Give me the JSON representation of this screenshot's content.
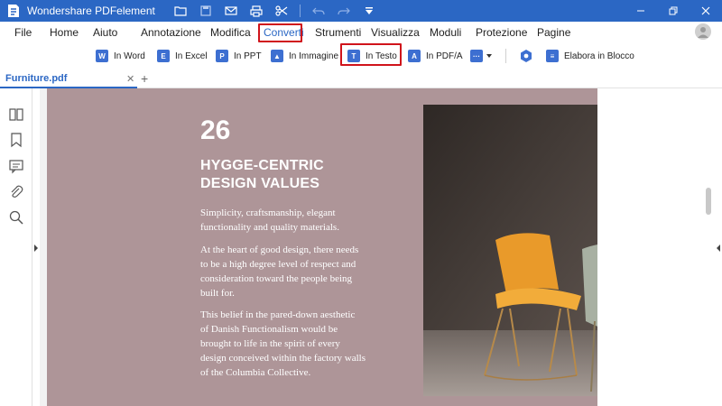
{
  "app": {
    "title": "Wondershare PDFelement"
  },
  "colors": {
    "accent": "#2b67c4",
    "highlight": "#d0141b",
    "page_bg": "#ae9598",
    "chair_yellow": "#e99a2a"
  },
  "menu": {
    "items": [
      "File",
      "Home",
      "Aiuto",
      "Annotazione",
      "Modifica",
      "Converti",
      "Strumenti",
      "Visualizza",
      "Moduli",
      "Protezione",
      "Pagine"
    ],
    "active": "Converti"
  },
  "toolbar": {
    "in_word": "In Word",
    "in_excel": "In Excel",
    "in_ppt": "In PPT",
    "in_immagine": "In Immagine",
    "in_testo": "In Testo",
    "in_pdfa": "In PDF/A",
    "elabora": "Elabora in Blocco"
  },
  "tabs": {
    "file": "Furniture.pdf"
  },
  "document": {
    "number": "26",
    "heading_1": "HYGGE-CENTRIC",
    "heading_2": "DESIGN VALUES",
    "para1": [
      "Simplicity, craftsmanship, elegant",
      "functionality and quality materials."
    ],
    "para2": [
      "At the heart of good design, there needs",
      "to be a high degree level of respect and",
      "consideration toward the people being",
      "built for."
    ],
    "para3": [
      "This belief in the pared-down aesthetic",
      "of Danish Functionalism would be",
      "brought to life in the spirit of every",
      "design conceived within the factory walls",
      "of the Columbia Collective."
    ]
  },
  "icons": {
    "titlebar": [
      "app-logo-icon",
      "folder-icon",
      "save-icon",
      "mail-icon",
      "print-icon",
      "scissors-icon",
      "undo-icon",
      "redo-icon",
      "quick-access-dropdown-icon"
    ],
    "window": [
      "minimize-icon",
      "maximize-icon",
      "close-icon"
    ],
    "left_panel": [
      "thumbnails-icon",
      "bookmark-icon",
      "comment-icon",
      "attachment-icon",
      "search-icon"
    ]
  }
}
